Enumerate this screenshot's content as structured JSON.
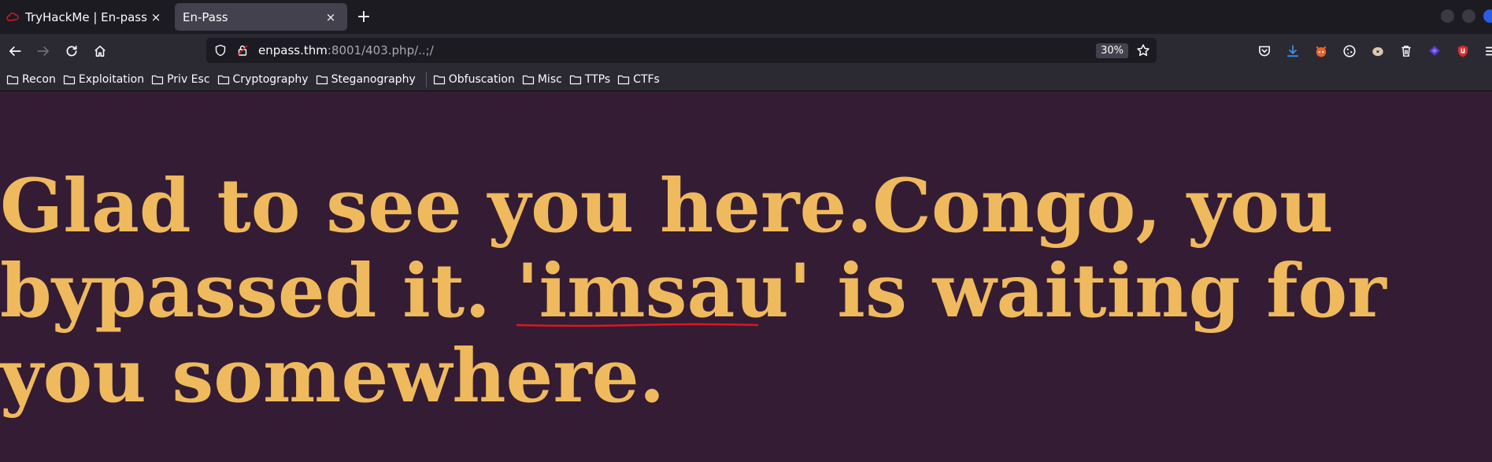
{
  "tabs": [
    {
      "title": "TryHackMe | En-pass",
      "active": false,
      "favicon": "tryhackme-cloud-icon"
    },
    {
      "title": "En-Pass",
      "active": true
    }
  ],
  "new_tab_label": "+",
  "close_glyph": "×",
  "nav": {
    "url_host": "enpass.thm",
    "url_rest": ":8001/403.php/..;/",
    "zoom": "30%"
  },
  "extensions": [
    "pocket-icon",
    "downloads-icon",
    "foxyproxy-icon",
    "cookie-icon",
    "privacy-badger-icon",
    "trash-icon",
    "wappalyzer-icon",
    "ublock-icon",
    "menu-icon"
  ],
  "bookmarks": [
    {
      "label": "Recon"
    },
    {
      "label": "Exploitation"
    },
    {
      "label": "Priv Esc"
    },
    {
      "label": "Cryptography"
    },
    {
      "label": "Steganography"
    },
    {
      "label": "Obfuscation"
    },
    {
      "label": "Misc"
    },
    {
      "label": "TTPs"
    },
    {
      "label": "CTFs"
    }
  ],
  "page": {
    "message_part1": "Glad to see you here.Congo, you bypassed it. '",
    "message_highlight": "imsau",
    "message_part2": "' is waiting for you somewhere."
  },
  "colors": {
    "page_background": "#341c34",
    "message_text": "#efba5e",
    "spellcheck_underline": "#e0161e",
    "chrome_dark": "#1c1b22",
    "chrome_toolbar": "#2b2a33"
  }
}
